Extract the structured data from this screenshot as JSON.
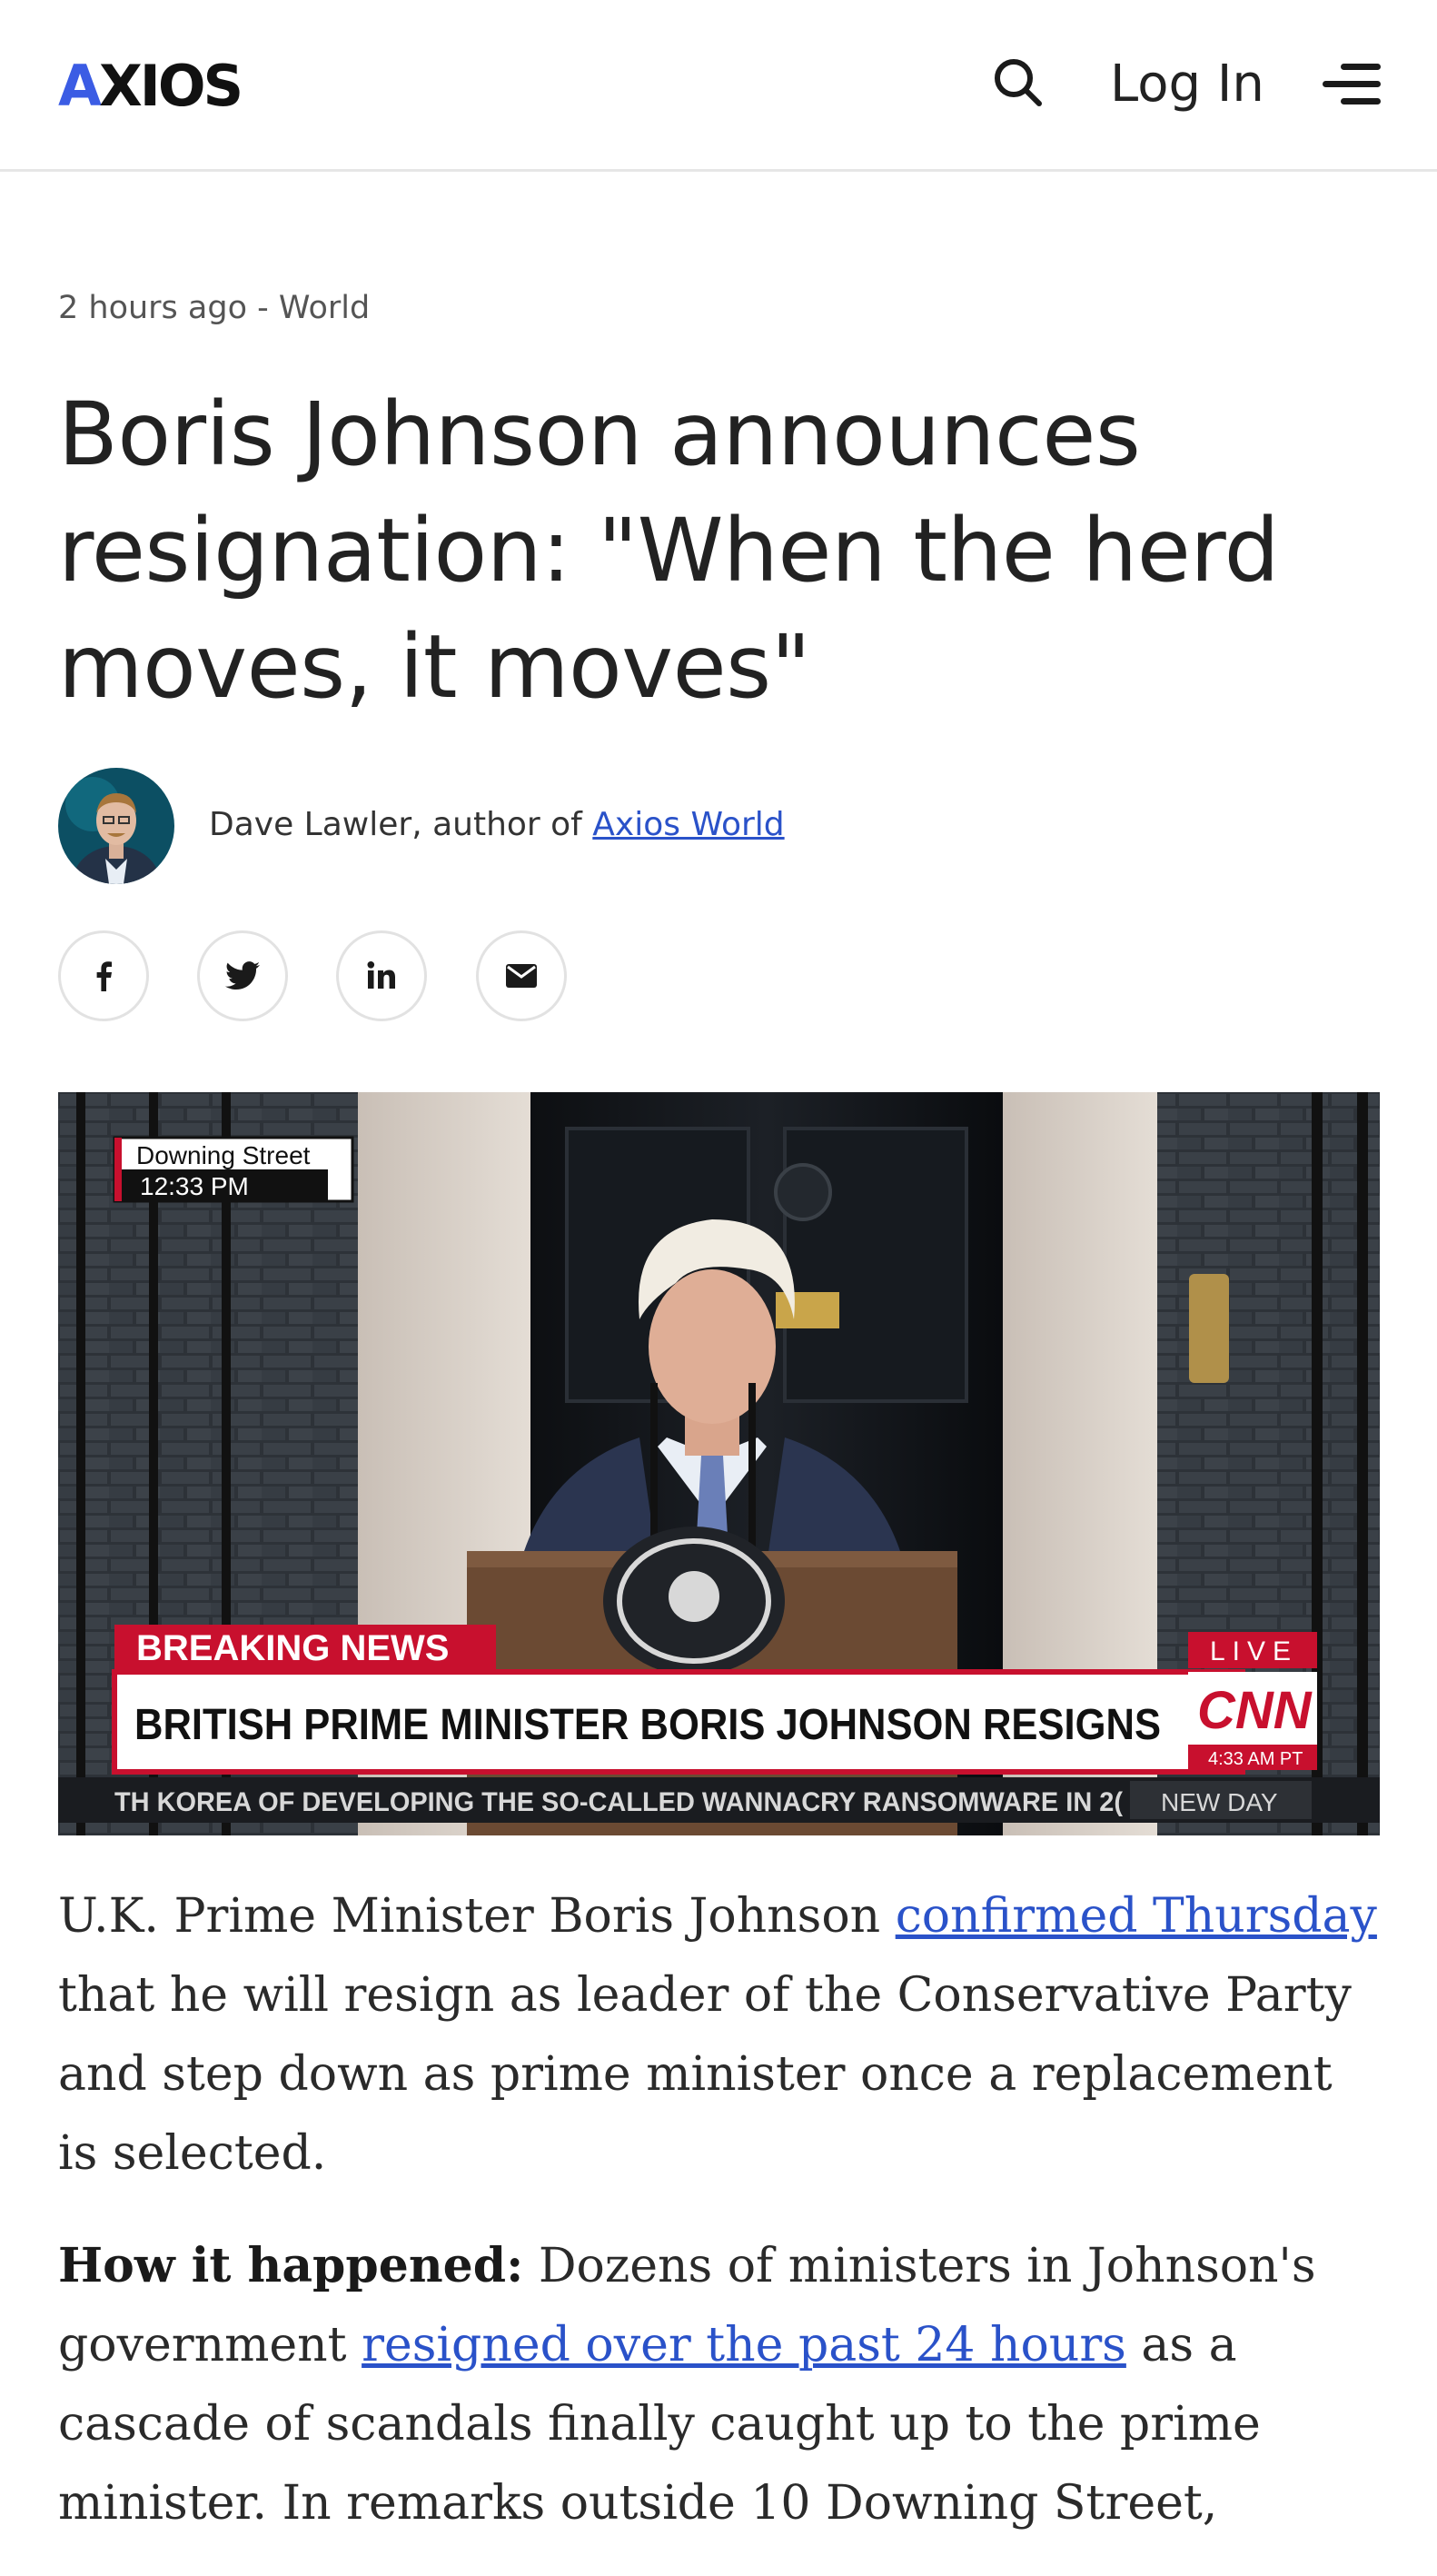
{
  "header": {
    "logo": {
      "prefix": "A",
      "rest": "XIOS"
    },
    "login_label": "Log In",
    "icons": {
      "search": "search-icon",
      "menu": "menu-icon"
    }
  },
  "meta": {
    "time": "2 hours ago",
    "separator": " - ",
    "section": "World"
  },
  "headline": "Boris Johnson announces resignation: \"When the herd moves, it moves\"",
  "byline": {
    "text": "Dave Lawler, author of ",
    "link": "Axios World"
  },
  "share": {
    "facebook": "facebook-icon",
    "twitter": "twitter-icon",
    "linkedin": "linkedin-icon",
    "email": "email-icon"
  },
  "hero": {
    "location": "Downing Street",
    "time": "12:33 PM",
    "breaking": "BREAKING NEWS",
    "headline": "BRITISH PRIME MINISTER BORIS JOHNSON RESIGNS",
    "live": "LIVE",
    "network": "CNN",
    "clock": "4:33 AM PT",
    "ticker": "TH KOREA OF DEVELOPING THE SO-CALLED WANNACRY RANSOMWARE IN 2(",
    "show": "NEW DAY"
  },
  "article": {
    "p1": {
      "before": "U.K. Prime Minister Boris Johnson ",
      "link": "confirmed Thursday",
      "after": " that he will resign as leader of the Conservative Party and step down as prime minister once a replacement is selected."
    },
    "p2": {
      "lead": "How it happened:",
      "before": " Dozens of ministers in Johnson's government ",
      "link": "resigned over the past 24 hours",
      "after": " as a cascade of scandals finally caught up to the prime minister. In remarks outside 10 Downing Street,"
    }
  },
  "colors": {
    "accent": "#3b5ce4",
    "link": "#2a52c9",
    "breaking_red": "#c8102e"
  }
}
